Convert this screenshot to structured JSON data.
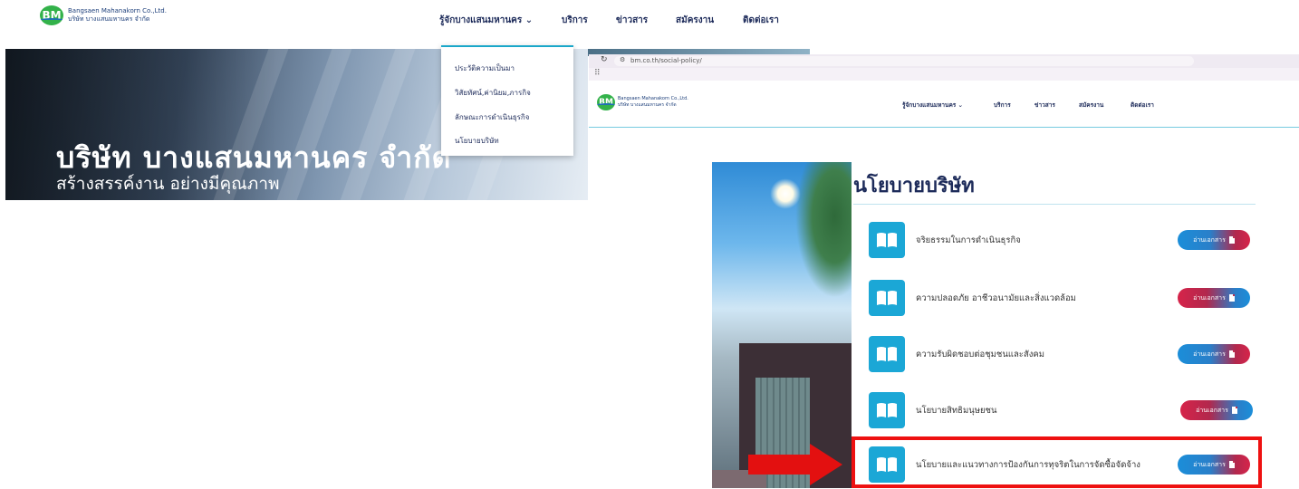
{
  "site": {
    "logo_en": "Bangsaen Mahanakorn Co.,Ltd.",
    "logo_th": "บริษัท บางแสนมหานคร จำกัด",
    "logo_mark": "BM",
    "nav": [
      {
        "label": "รู้จักบางแสนมหานคร ⌄"
      },
      {
        "label": "บริการ"
      },
      {
        "label": "ข่าวสาร"
      },
      {
        "label": "สมัครงาน"
      },
      {
        "label": "ติดต่อเรา"
      }
    ],
    "dropdown": [
      {
        "label": "ประวัติความเป็นมา"
      },
      {
        "label": "วิสัยทัศน์,ค่านิยม,ภารกิจ"
      },
      {
        "label": "ลักษณะการดำเนินธุรกิจ"
      },
      {
        "label": "นโยบายบริษัท"
      }
    ]
  },
  "hero": {
    "title": "บริษัท บางแสนมหานคร จำกัด",
    "subtitle": "สร้างสรรค์งาน อย่างมีคุณภาพ"
  },
  "browser": {
    "url": "bm.co.th/social-policy/",
    "logo_en": "Bangsaen Mahanakorn Co.,Ltd.",
    "logo_th": "บริษัท บางแสนมหานคร จำกัด",
    "nav": [
      {
        "label": "รู้จักบางแสนมหานคร ⌄"
      },
      {
        "label": "บริการ"
      },
      {
        "label": "ข่าวสาร"
      },
      {
        "label": "สมัครงาน"
      },
      {
        "label": "ติดต่อเรา"
      }
    ]
  },
  "policy": {
    "title": "นโยบายบริษัท",
    "button_label": "อ่านเอกสาร",
    "items": [
      {
        "label": "จริยธรรมในการดำเนินธุรกิจ"
      },
      {
        "label": "ความปลอดภัย อาชีวอนามัยและสิ่งแวดล้อม"
      },
      {
        "label": "ความรับผิดชอบต่อชุมชนและสังคม"
      },
      {
        "label": "นโยบายสิทธิมนุษยชน"
      },
      {
        "label": "นโยบายและแนวทางการป้องกันการทุจริตในการจัดซื้อจัดจ้าง"
      }
    ]
  },
  "colors": {
    "brand_navy": "#1d2b5a",
    "accent_cyan": "#1aa7c9",
    "icon_blue": "#1ba7d6",
    "highlight_red": "#ee1111"
  },
  "icons": {
    "book": "book-icon",
    "document": "document-icon",
    "reload": "reload-icon",
    "apps": "apps-icon",
    "arrow": "red-arrow"
  }
}
